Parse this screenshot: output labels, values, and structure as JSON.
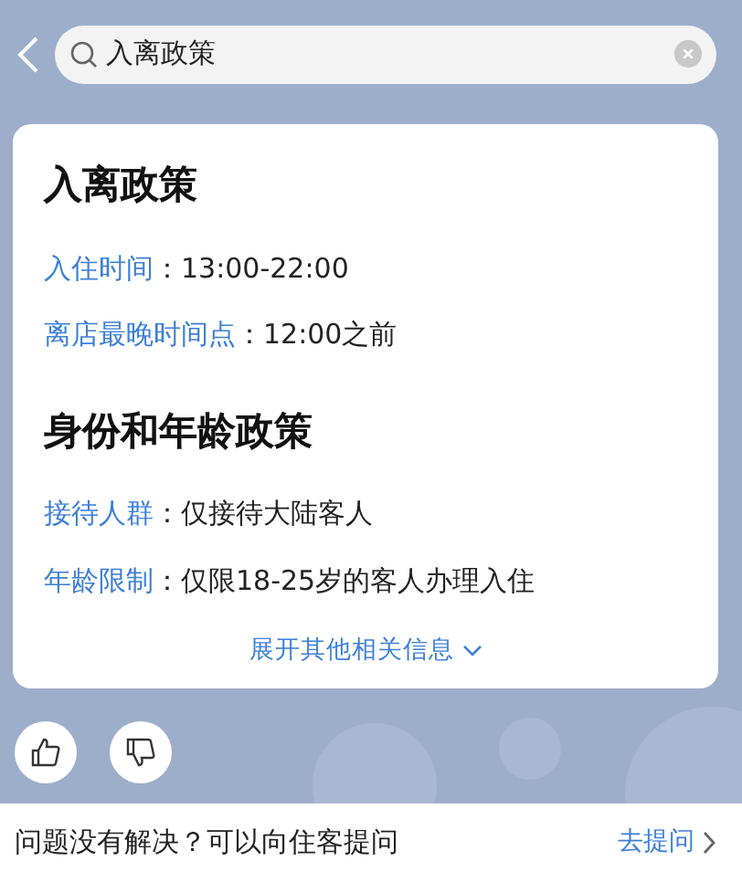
{
  "search": {
    "value": "入离政策"
  },
  "sections": [
    {
      "title": "入离政策",
      "items": [
        {
          "label": "入住时间",
          "value": "：13:00-22:00"
        },
        {
          "label": "离店最晚时间点",
          "value": "：12:00之前"
        }
      ]
    },
    {
      "title": "身份和年龄政策",
      "items": [
        {
          "label": "接待人群",
          "value": "：仅接待大陆客人"
        },
        {
          "label": "年龄限制",
          "value": "：仅限18-25岁的客人办理入住"
        }
      ]
    }
  ],
  "expand_link": "展开其他相关信息",
  "footer": {
    "text": "问题没有解决？可以向住客提问",
    "link": "去提问"
  }
}
